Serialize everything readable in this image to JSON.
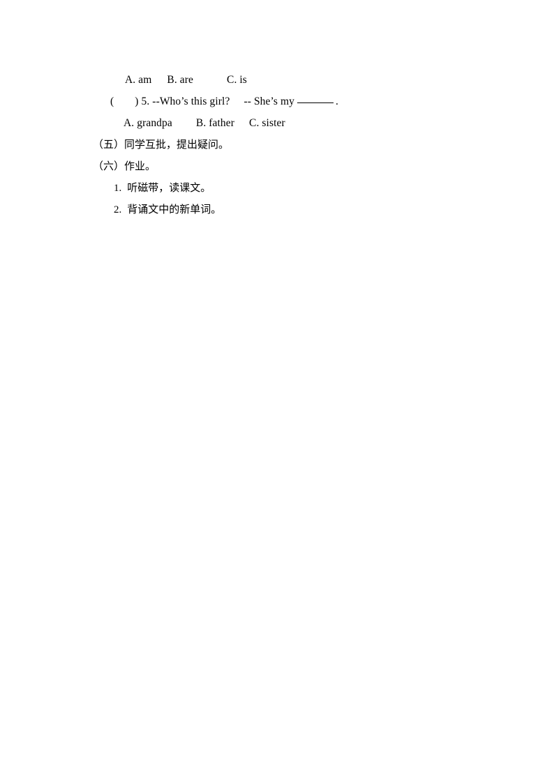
{
  "document": {
    "page_background": "#ffffff",
    "text_color": "#000000",
    "lines": [
      {
        "id": "options-row-1",
        "script": "latin",
        "indent": "ind-opt1",
        "parts": [
          {
            "text": "A. am"
          },
          {
            "gap": "gap-a"
          },
          {
            "text": "B. are"
          },
          {
            "gap": "gap-b"
          },
          {
            "text": "C. is"
          }
        ]
      },
      {
        "id": "question-5",
        "script": "latin",
        "indent": "ind-q",
        "parts": [
          {
            "text": "("
          },
          {
            "gap": "gap-paren"
          },
          {
            "text": ") 5. --Who’s this girl?"
          },
          {
            "gap": "gap-dash"
          },
          {
            "text": "-- She’s my"
          },
          {
            "blank": true
          },
          {
            "text": "."
          }
        ]
      },
      {
        "id": "options-row-2",
        "script": "latin",
        "indent": "ind-opt2",
        "parts": [
          {
            "text": "A. grandpa"
          },
          {
            "gap": "gap-c"
          },
          {
            "text": "B. father"
          },
          {
            "gap": "gap-d"
          },
          {
            "text": "C. sister"
          }
        ]
      },
      {
        "id": "section-five",
        "script": "cjk",
        "indent": "ind-sect",
        "parts": [
          {
            "text": "（五）同学互批，提出疑问。"
          }
        ]
      },
      {
        "id": "section-six",
        "script": "cjk",
        "indent": "ind-sect",
        "parts": [
          {
            "text": "（六）作业。"
          }
        ]
      },
      {
        "id": "homework-item-1",
        "script": "cjk",
        "indent": "ind-num",
        "parts": [
          {
            "text": "1.",
            "marker": true
          },
          {
            "gap": "gap-num"
          },
          {
            "text": "听磁带，读课文。"
          }
        ]
      },
      {
        "id": "homework-item-2",
        "script": "cjk",
        "indent": "ind-num",
        "parts": [
          {
            "text": "2.",
            "marker": true
          },
          {
            "gap": "gap-num"
          },
          {
            "text": "背诵文中的新单词。"
          }
        ]
      }
    ],
    "plain_text": {
      "options_row_1": "A. am    B. are       C. is",
      "question_5": "(     ) 5. --Who’s this girl?    -- She’s my ________ .",
      "options_row_2": "A. grandpa      B. father    C. sister",
      "section_five": "（五）同学互批，提出疑问。",
      "section_six": "（六）作业。",
      "homework_item_1": "1. 听磁带，读课文。",
      "homework_item_2": "2. 背诵文中的新单词。"
    }
  }
}
